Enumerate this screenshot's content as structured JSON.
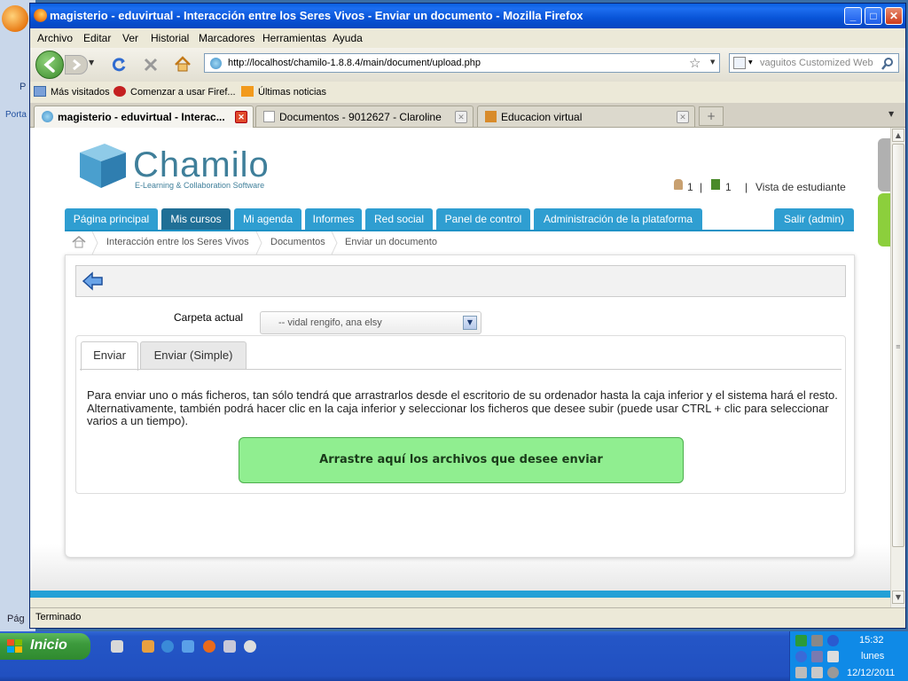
{
  "window": {
    "title": "magisterio - eduvirtual - Interacción entre los Seres Vivos - Enviar un documento - Mozilla Firefox"
  },
  "menu": [
    "Archivo",
    "Editar",
    "Ver",
    "Historial",
    "Marcadores",
    "Herramientas",
    "Ayuda"
  ],
  "navigation": {
    "url": "http://localhost/chamilo-1.8.8.4/main/document/upload.php",
    "search_placeholder": "vaguitos Customized Web Se"
  },
  "bookmarks": [
    "Más visitados",
    "Comenzar a usar Firef...",
    "Últimas noticias"
  ],
  "tabs": [
    {
      "label": "magisterio - eduvirtual - Interac...",
      "active": true
    },
    {
      "label": "Documentos - 9012627 - Claroline",
      "active": false
    },
    {
      "label": "Educacion virtual",
      "active": false
    }
  ],
  "background_app": {
    "p": "P",
    "porta": "Porta",
    "pag": "Pág"
  },
  "status": "Terminado",
  "chamilo": {
    "logo_name": "Chamilo",
    "logo_tagline": "E-Learning & Collaboration Software",
    "user_count": "1",
    "message_count": "1",
    "student_view": "Vista de estudiante",
    "separator": "|",
    "top_menu": [
      {
        "label": "Página principal"
      },
      {
        "label": "Mis cursos",
        "selected": true
      },
      {
        "label": "Mi agenda"
      },
      {
        "label": "Informes"
      },
      {
        "label": "Red social"
      },
      {
        "label": "Panel de control"
      },
      {
        "label": "Administración de la plataforma"
      }
    ],
    "logout": "Salir (admin)",
    "breadcrumb": [
      "Interacción entre los Seres Vivos",
      "Documentos",
      "Enviar un documento"
    ],
    "folder_label": "Carpeta actual",
    "folder_value": "-- vidal rengifo, ana elsy",
    "upload_tabs": [
      "Enviar",
      "Enviar (Simple)"
    ],
    "description": "Para enviar uno o más ficheros, tan sólo tendrá que arrastrarlos desde el escritorio de su ordenador hasta la caja inferior y el sistema hará el resto. Alternativamente, también podrá hacer clic en la caja inferior y seleccionar los ficheros que desee subir (puede usar CTRL + clic para seleccionar varios a un tiempo).",
    "dropzone": "Arrastre aquí los archivos que desee enviar"
  },
  "taskbar": {
    "start": "Inicio",
    "time": "15:32",
    "day": "lunes",
    "date": "12/12/2011"
  }
}
